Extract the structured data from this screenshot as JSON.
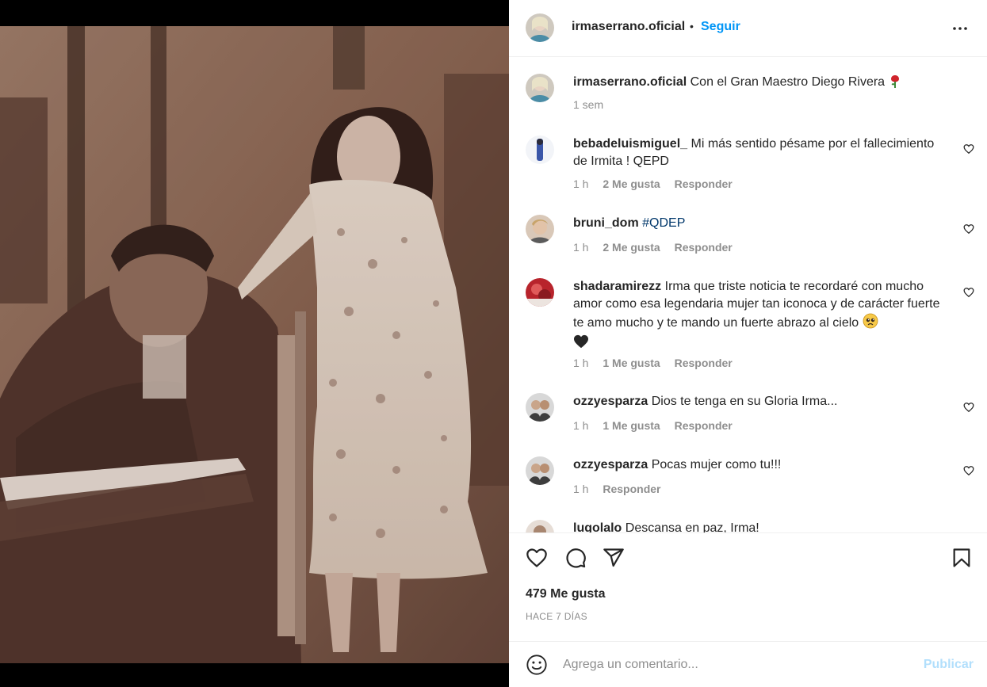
{
  "post": {
    "author": "irmaserrano.oficial",
    "follow_label": "Seguir",
    "separator": "•",
    "caption_user": "irmaserrano.oficial",
    "caption_text": "Con el Gran Maestro Diego Rivera",
    "caption_time": "1 sem"
  },
  "comments": [
    {
      "user": "bebadeluismiguel_",
      "text": " Mi más sentido pésame por el fallecimiento de Irmita ! QEPD",
      "time": "1 h",
      "likes": "2 Me gusta",
      "reply": "Responder"
    },
    {
      "user": "bruni_dom",
      "text": "",
      "tag": "#QDEP",
      "time": "1 h",
      "likes": "2 Me gusta",
      "reply": "Responder"
    },
    {
      "user": "shadaramirezz",
      "text": " Irma que triste noticia te recordaré con mucho amor como esa legendaria mujer tan iconoca y de carácter fuerte te amo mucho y te mando un fuerte abrazo al cielo",
      "time": "1 h",
      "likes": "1 Me gusta",
      "reply": "Responder"
    },
    {
      "user": "ozzyesparza",
      "text": " Dios te tenga en su Gloria Irma...",
      "time": "1 h",
      "likes": "1 Me gusta",
      "reply": "Responder"
    },
    {
      "user": "ozzyesparza",
      "text": " Pocas mujer como tu!!!",
      "time": "1 h",
      "reply": "Responder"
    },
    {
      "user": "lugolalo",
      "text": " Descansa en paz, Irma!"
    }
  ],
  "stats": {
    "likes": "479 Me gusta",
    "time_ago": "HACE 7 DÍAS"
  },
  "composer": {
    "placeholder": "Agrega un comentario...",
    "publish_label": "Publicar"
  },
  "colors": {
    "accent": "#0095f6",
    "publish_disabled": "#b2dffc",
    "text": "#262626",
    "muted": "#8e8e8e",
    "hashtag": "#00376b"
  },
  "icons": [
    "more-options-icon",
    "heart-icon",
    "comment-icon",
    "share-icon",
    "save-icon",
    "emoji-icon",
    "rose-emoji",
    "pleading-emoji",
    "black-heart-emoji"
  ]
}
